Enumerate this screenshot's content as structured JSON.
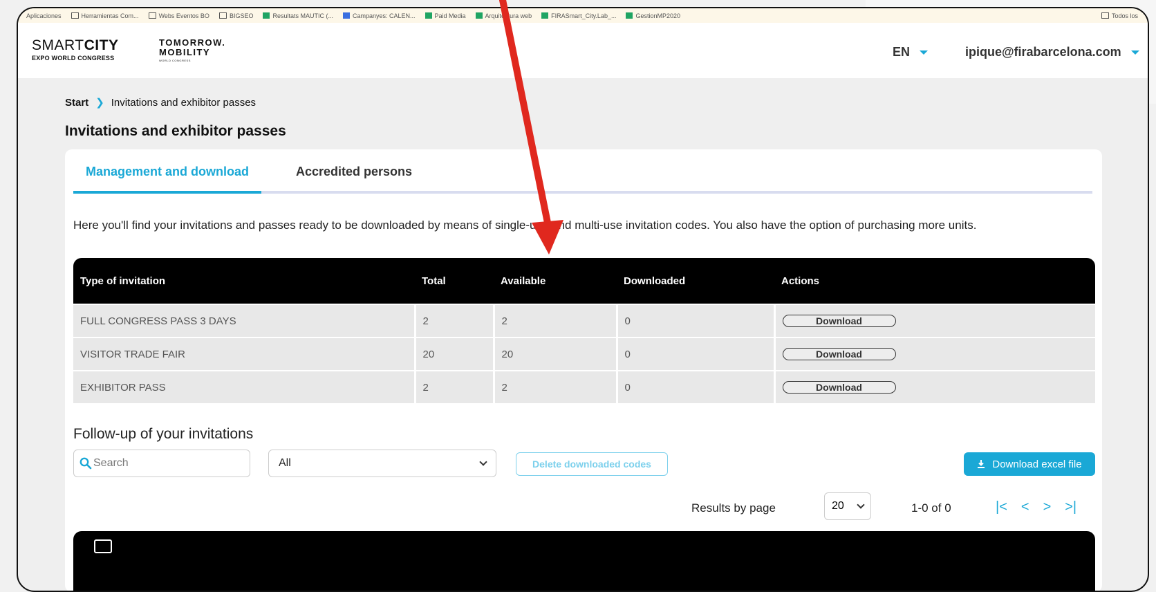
{
  "bookmarks": {
    "items": [
      "Aplicaciones",
      "Herramientas Com...",
      "Webs Eventos BO",
      "BIGSEO",
      "Resultats MAUTIC (...",
      "Campanyes: CALEN...",
      "Paid Media",
      "Arquitectura web",
      "FIRASmart_City.Lab_...",
      "GestionMP2020"
    ],
    "right": "Todos los"
  },
  "header": {
    "logo_smartcity_light": "SMART",
    "logo_smartcity_bold": "CITY",
    "logo_smartcity_sub": "EXPO WORLD CONGRESS",
    "logo_tm_line1": "TOMORROW.",
    "logo_tm_line2": "MOBILITY",
    "logo_tm_sub": "WORLD CONGRESS",
    "lang": "EN",
    "user_email": "ipique@firabarcelona.com"
  },
  "breadcrumb": {
    "start": "Start",
    "current": "Invitations and exhibitor passes"
  },
  "page_title": "Invitations and exhibitor passes",
  "tabs": [
    {
      "label": "Management and download"
    },
    {
      "label": "Accredited persons"
    }
  ],
  "description": "Here you'll find your invitations and passes ready to be downloaded by means of single-use and multi-use invitation codes. You also have the option of purchasing more units.",
  "table": {
    "headers": [
      "Type of invitation",
      "Total",
      "Available",
      "Downloaded",
      "Actions"
    ],
    "rows": [
      {
        "type": "FULL CONGRESS PASS 3 DAYS",
        "total": "2",
        "available": "2",
        "downloaded": "0",
        "action": "Download"
      },
      {
        "type": "VISITOR TRADE FAIR",
        "total": "20",
        "available": "20",
        "downloaded": "0",
        "action": "Download"
      },
      {
        "type": "EXHIBITOR PASS",
        "total": "2",
        "available": "2",
        "downloaded": "0",
        "action": "Download"
      }
    ]
  },
  "followup": {
    "title": "Follow-up of your invitations",
    "search_placeholder": "Search",
    "filter_value": "All",
    "delete_label": "Delete downloaded codes",
    "excel_label": "Download excel file",
    "results_label": "Results by page",
    "per_page": "20",
    "range": "1-0 of 0"
  },
  "colors": {
    "accent": "#1aa8d6",
    "arrow": "#e0281e"
  }
}
